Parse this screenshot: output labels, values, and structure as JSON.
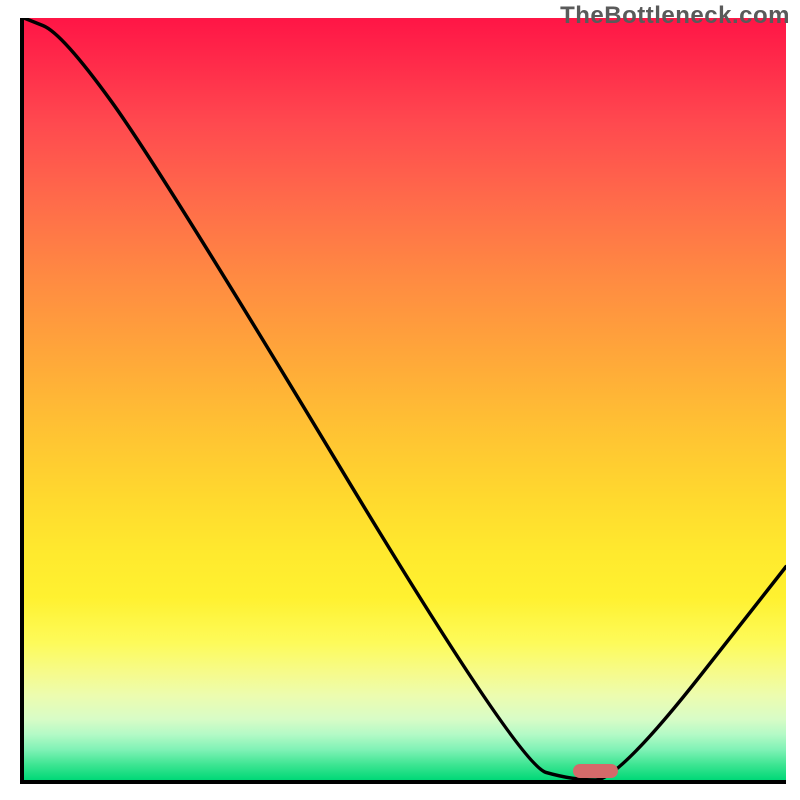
{
  "watermark": "TheBottleneck.com",
  "colors": {
    "good": "#00d877",
    "bad": "#ff1546",
    "curve": "#000000",
    "marker": "#d46a6a",
    "axis": "#000000"
  },
  "chart_data": {
    "type": "line",
    "title": "",
    "xlabel": "",
    "ylabel": "",
    "xlim": [
      0,
      100
    ],
    "ylim": [
      0,
      100
    ],
    "grid": false,
    "legend": false,
    "x": [
      0,
      5,
      18,
      65,
      72,
      78,
      100
    ],
    "values": [
      100,
      98,
      80,
      2,
      0,
      0,
      28
    ],
    "gradient_stops": [
      {
        "pos": 0,
        "color": "#ff1546"
      },
      {
        "pos": 50,
        "color": "#ffc233"
      },
      {
        "pos": 80,
        "color": "#fff130"
      },
      {
        "pos": 100,
        "color": "#00d877"
      }
    ],
    "marker": {
      "x_start": 72,
      "x_end": 78,
      "y": 0
    }
  }
}
